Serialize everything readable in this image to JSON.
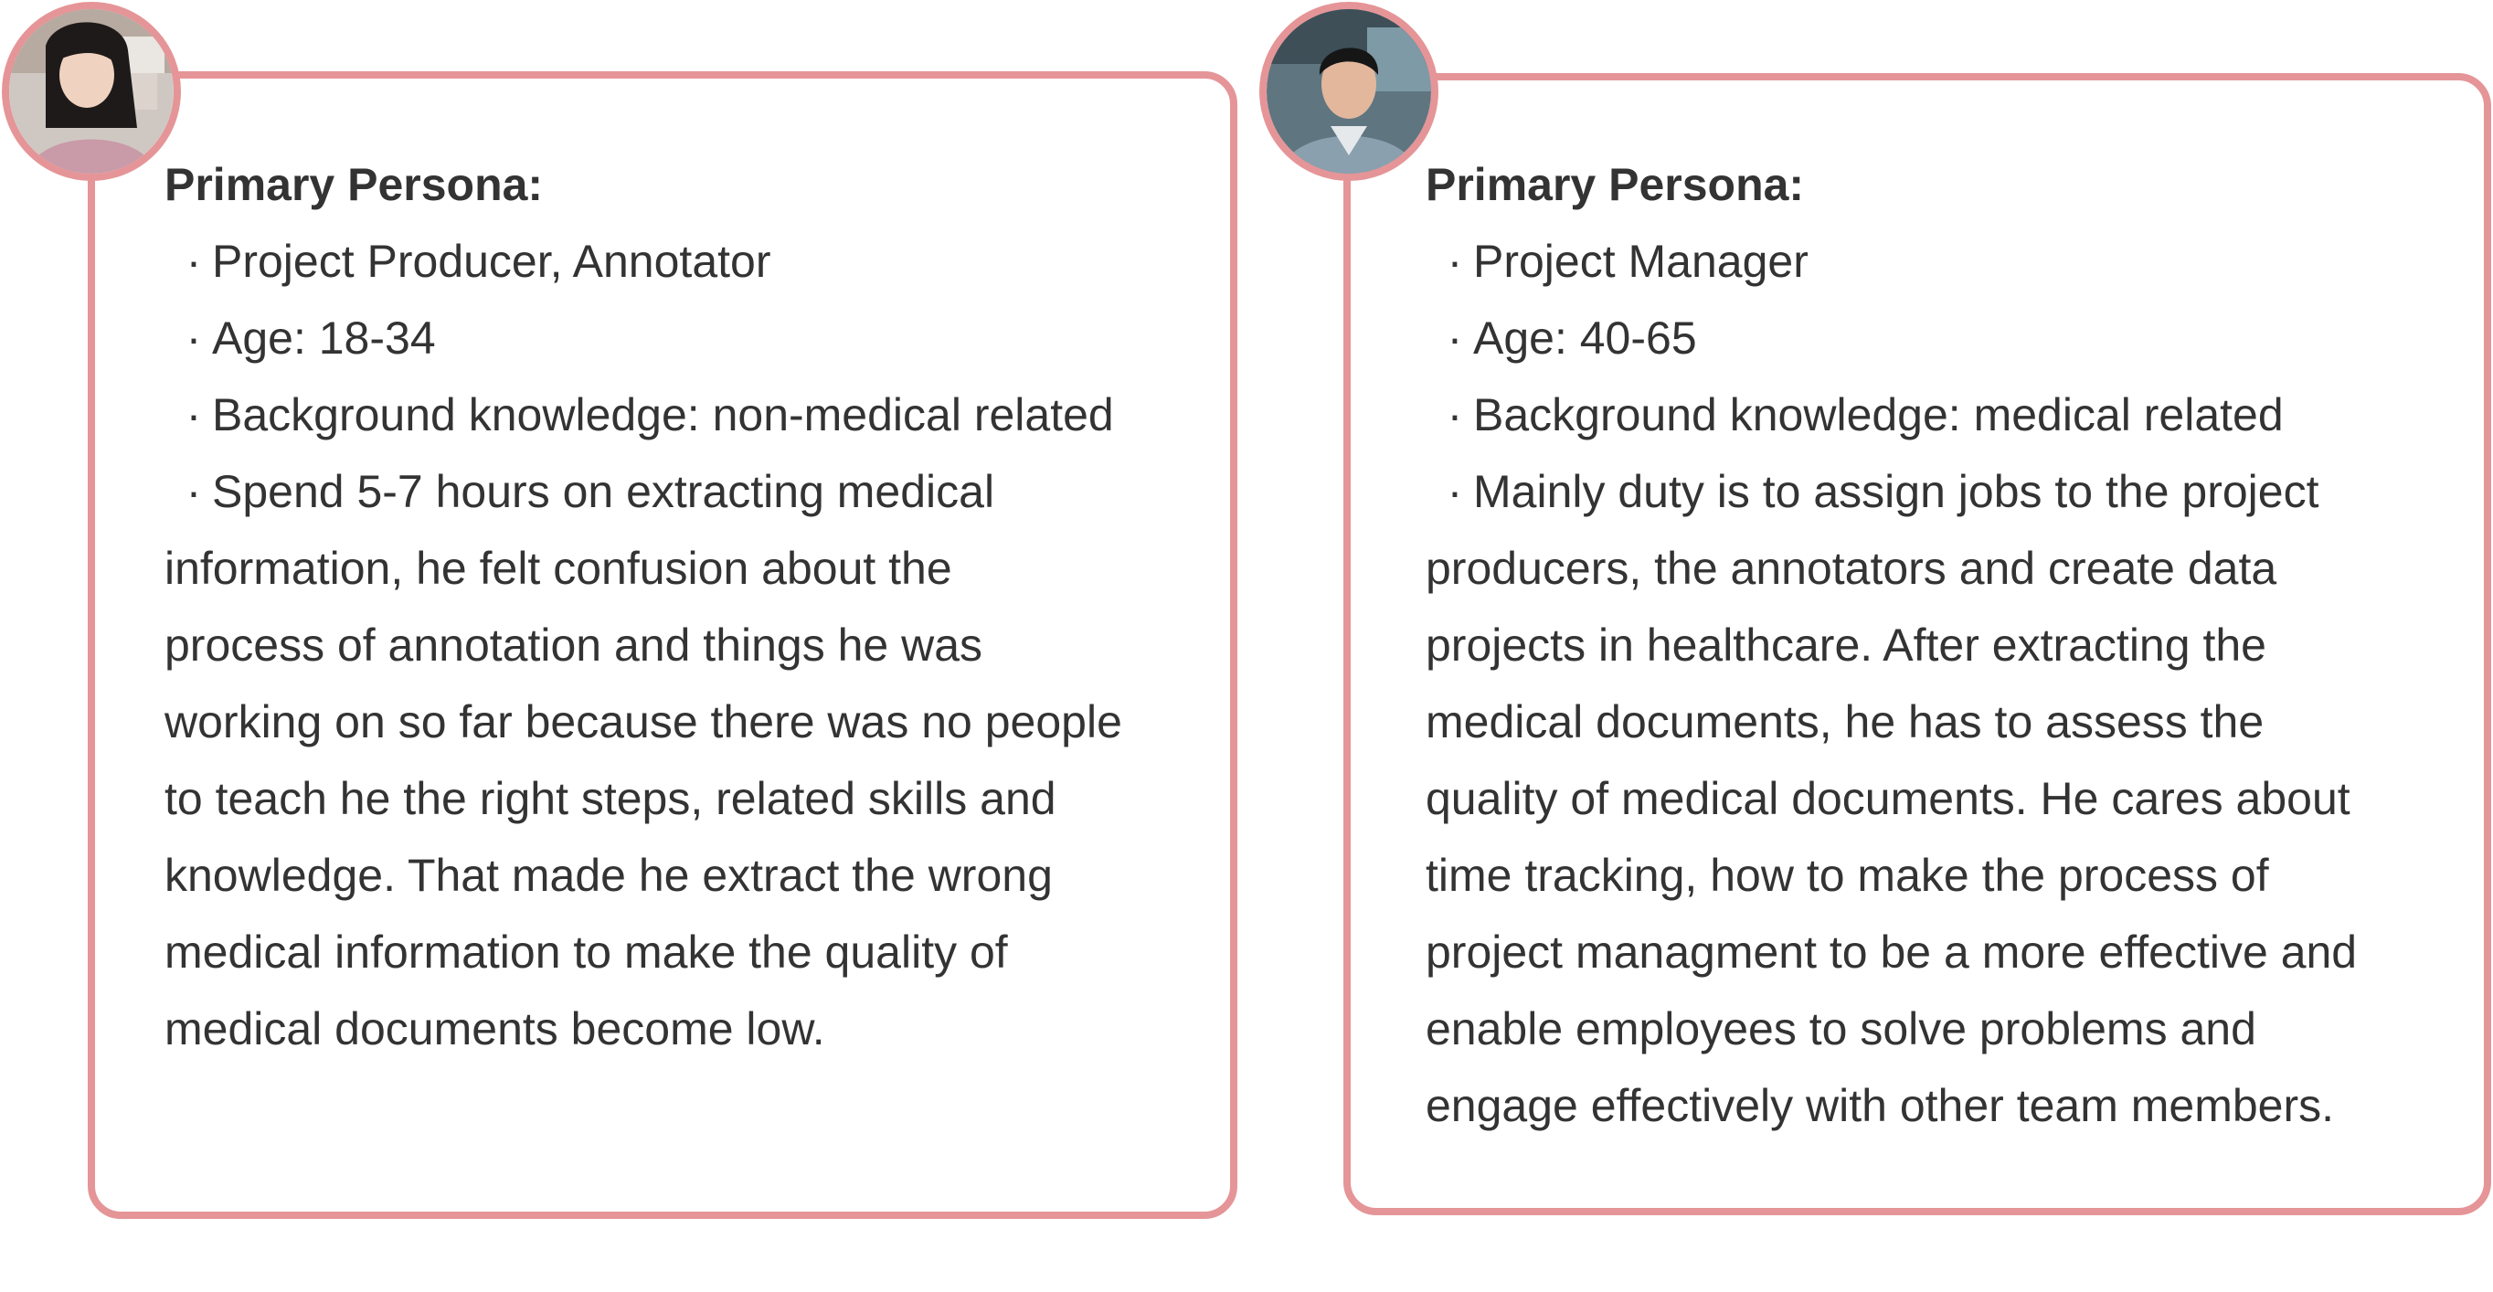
{
  "colors": {
    "border": "#e59597",
    "text": "#333333"
  },
  "personas": [
    {
      "heading": "Primary Persona:",
      "bullet_glyph": "·",
      "bullets": [
        "Project Producer, Annotator",
        "Age: 18-34",
        "Background knowledge: non-medical related",
        "Spend 5-7 hours on extracting medical"
      ],
      "continuation": [
        "information, he felt confusion about the",
        "process of annotation and things he was",
        "working on so far because there was no people",
        "to teach he the right steps, related skills and",
        "knowledge. That made he extract the wrong",
        "medical information to make the quality of",
        "medical documents become low."
      ],
      "avatar_icon": "woman-avatar-photo"
    },
    {
      "heading": "Primary Persona:",
      "bullet_glyph": "·",
      "bullets": [
        "Project Manager",
        "Age: 40-65",
        "Background knowledge: medical related",
        "Mainly duty is to assign jobs to the project"
      ],
      "continuation": [
        "producers, the annotators and create data",
        "projects in healthcare. After extracting the",
        "medical documents, he has to assess the",
        "quality of medical documents. He cares about",
        "time tracking, how to make the process of",
        "project managment to be a more effective and",
        "enable employees to solve problems and",
        "engage effectively with other team members."
      ],
      "avatar_icon": "man-avatar-photo"
    }
  ]
}
